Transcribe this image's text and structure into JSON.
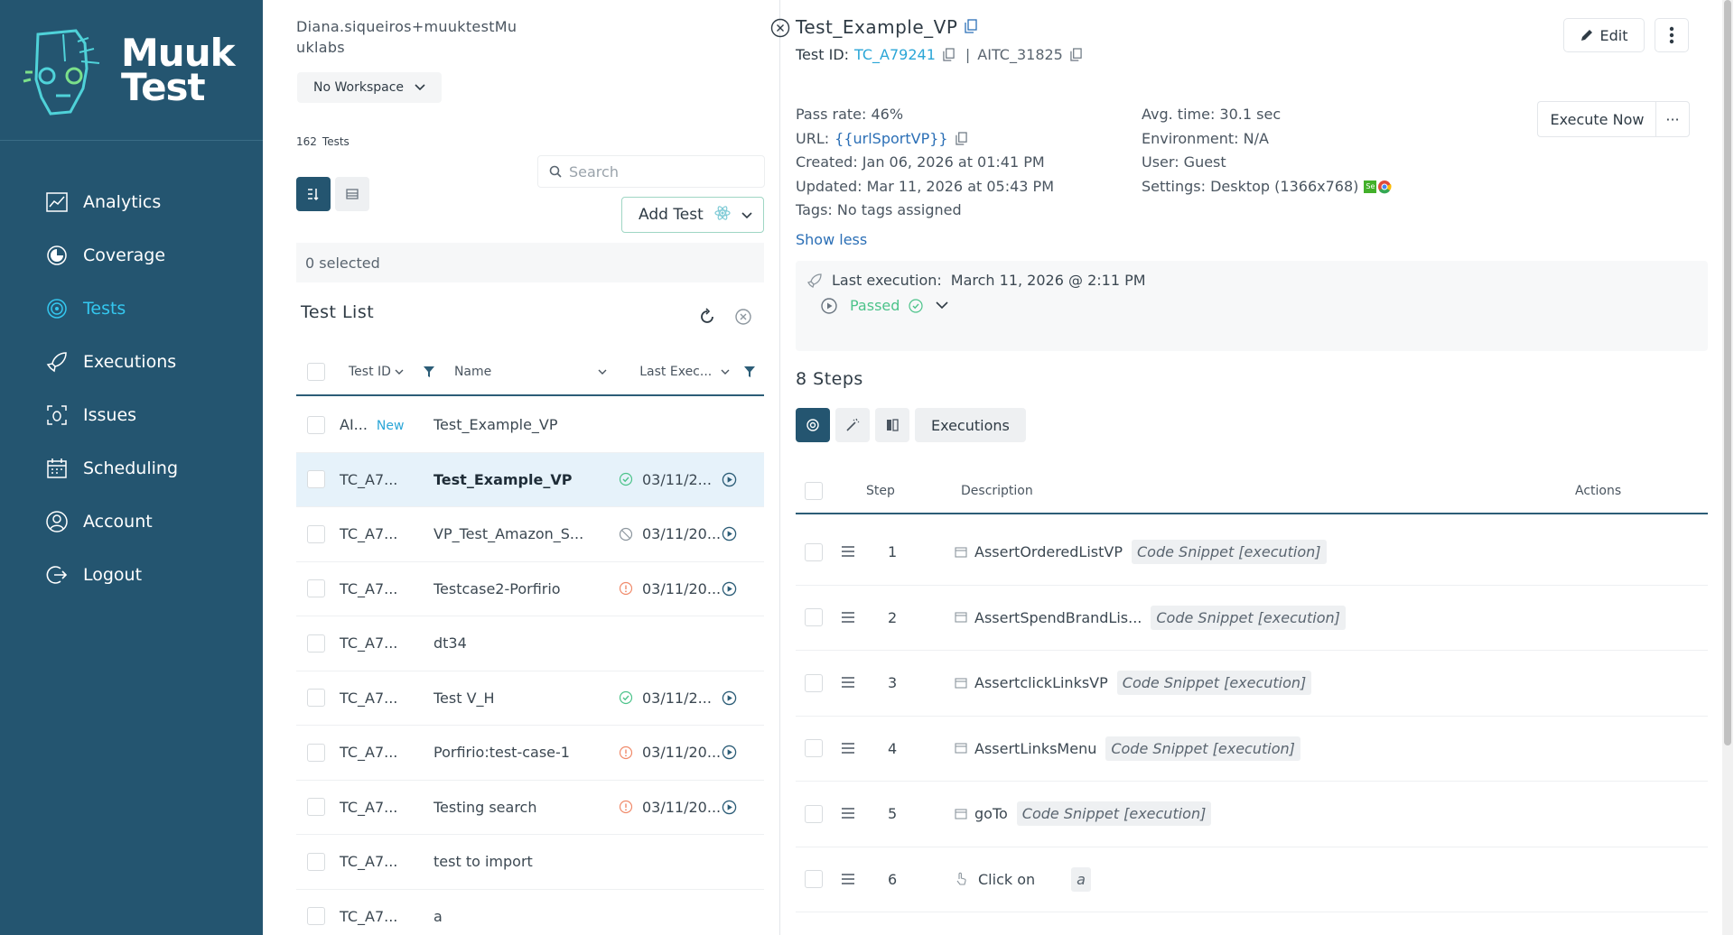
{
  "brand": {
    "name": "Muuk",
    "name2": "Test",
    "mark": "Muuk Test"
  },
  "nav": [
    {
      "label": "Analytics",
      "icon": "analytics-icon"
    },
    {
      "label": "Coverage",
      "icon": "coverage-icon"
    },
    {
      "label": "Tests",
      "icon": "tests-icon",
      "active": true
    },
    {
      "label": "Executions",
      "icon": "rocket-icon"
    },
    {
      "label": "Issues",
      "icon": "issues-icon"
    },
    {
      "label": "Scheduling",
      "icon": "calendar-icon"
    },
    {
      "label": "Account",
      "icon": "account-icon"
    },
    {
      "label": "Logout",
      "icon": "logout-icon"
    }
  ],
  "user": {
    "email_line1": "Diana.siqueiros+muuktestMu",
    "email_line2": "uklabs"
  },
  "workspace": {
    "label": "No Workspace"
  },
  "tests_count": {
    "count": "162",
    "label": "Tests"
  },
  "search": {
    "placeholder": "Search"
  },
  "add_test": {
    "label": "Add Test"
  },
  "selection": {
    "label": "0 selected"
  },
  "test_list": {
    "title": "Test List",
    "columns": {
      "id": "Test ID",
      "name": "Name",
      "last": "Last Exec..."
    },
    "rows": [
      {
        "id": "AI...",
        "badge": "New",
        "name": "Test_Example_VP",
        "status": "",
        "date": ""
      },
      {
        "id": "TC_A7...",
        "badge": "",
        "name": "Test_Example_VP",
        "status": "passed",
        "date": "03/11/2...",
        "selected": true
      },
      {
        "id": "TC_A7...",
        "badge": "",
        "name": "VP_Test_Amazon_S...",
        "status": "skipped",
        "date": "03/11/20..."
      },
      {
        "id": "TC_A7...",
        "badge": "",
        "name": "Testcase2-Porfirio",
        "status": "failed",
        "date": "03/11/20..."
      },
      {
        "id": "TC_A7...",
        "badge": "",
        "name": "dt34",
        "status": "",
        "date": ""
      },
      {
        "id": "TC_A7...",
        "badge": "",
        "name": "Test V_H",
        "status": "passed",
        "date": "03/11/2..."
      },
      {
        "id": "TC_A7...",
        "badge": "",
        "name": "Porfirio:test-case-1",
        "status": "failed",
        "date": "03/11/20..."
      },
      {
        "id": "TC_A7...",
        "badge": "",
        "name": "Testing search",
        "status": "failed",
        "date": "03/11/20..."
      },
      {
        "id": "TC_A7...",
        "badge": "",
        "name": "test to import",
        "status": "",
        "date": ""
      },
      {
        "id": "TC_A7...",
        "badge": "",
        "name": "a",
        "status": "",
        "date": ""
      }
    ]
  },
  "detail": {
    "title": "Test_Example_VP",
    "test_id_label": "Test ID:",
    "test_id": "TC_A79241",
    "aitc_id": "AITC_31825",
    "edit_label": "Edit",
    "execute_now": "Execute Now",
    "execute_more": "···",
    "pass_rate": "Pass rate: 46%",
    "url_label": "URL:",
    "url_value": "{{urlSportVP}}",
    "created": "Created: Jan 06, 2026 at 01:41 PM",
    "updated": "Updated: Mar 11, 2026 at 05:43 PM",
    "tags_label": "Tags:",
    "tags_value": "No tags assigned",
    "avg_time": "Avg. time: 30.1 sec",
    "environment": "Environment: N/A",
    "user": "User: Guest",
    "settings": "Settings: Desktop (1366x768)",
    "show_less": "Show less",
    "last_exec_label": "Last execution:",
    "last_exec_value": "March 11, 2026 @ 2:11 PM",
    "last_exec_status": "Passed"
  },
  "steps": {
    "title": "8 Steps",
    "executions_label": "Executions",
    "columns": {
      "step": "Step",
      "description": "Description",
      "actions": "Actions"
    },
    "rows": [
      {
        "num": "1",
        "name": "AssertOrderedListVP",
        "chip": "Code Snippet [execution]",
        "kind": "code"
      },
      {
        "num": "2",
        "name": "AssertSpendBrandLis...",
        "chip": "Code Snippet [execution]",
        "kind": "code"
      },
      {
        "num": "3",
        "name": "AssertclickLinksVP",
        "chip": "Code Snippet [execution]",
        "kind": "code"
      },
      {
        "num": "4",
        "name": "AssertLinksMenu",
        "chip": "Code Snippet [execution]",
        "kind": "code"
      },
      {
        "num": "5",
        "name": "goTo",
        "chip": "Code Snippet [execution]",
        "kind": "code"
      },
      {
        "num": "6",
        "name": "Click on",
        "chip": "a",
        "kind": "click"
      }
    ]
  },
  "colors": {
    "sidebar": "#245570",
    "active_nav": "#34c7ef",
    "link": "#2ba6d7",
    "passed": "#4cc38a",
    "failed": "#f08a6a"
  }
}
